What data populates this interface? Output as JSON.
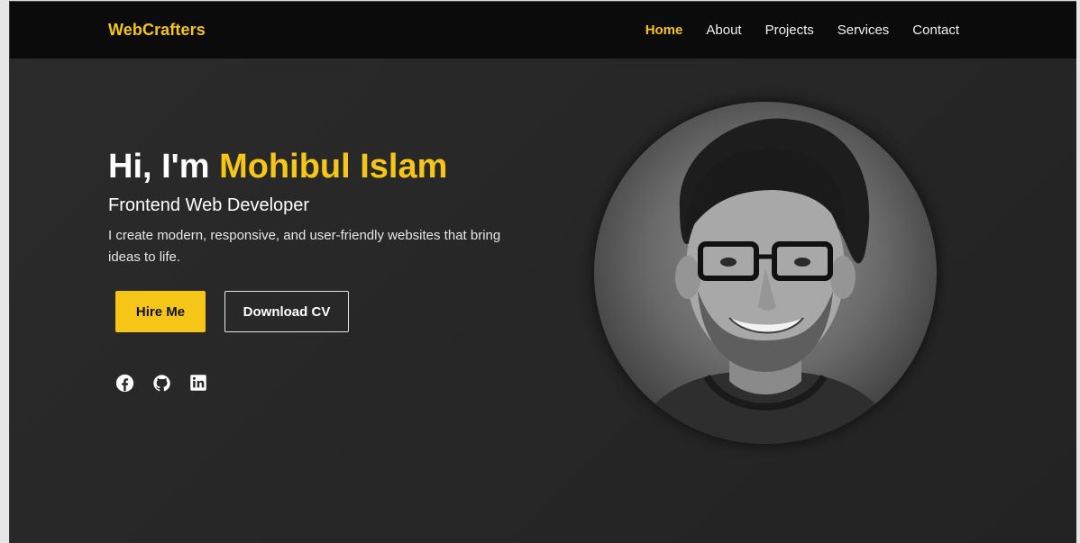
{
  "nav": {
    "brand": "WebCrafters",
    "links": [
      "Home",
      "About",
      "Projects",
      "Services",
      "Contact"
    ],
    "active": "Home"
  },
  "hero": {
    "greeting": "Hi, I'm ",
    "name": "Mohibul Islam",
    "role": "Frontend Web Developer",
    "description": "I create modern, responsive, and user-friendly websites that bring ideas to life.",
    "buttons": {
      "hire": "Hire Me",
      "download": "Download CV"
    },
    "socials": [
      "facebook-icon",
      "github-icon",
      "linkedin-icon"
    ]
  },
  "colors": {
    "accent": "#f5c518",
    "navbar_bg": "#0b0b0b",
    "page_bg": "#262626",
    "text": "#ffffff"
  }
}
